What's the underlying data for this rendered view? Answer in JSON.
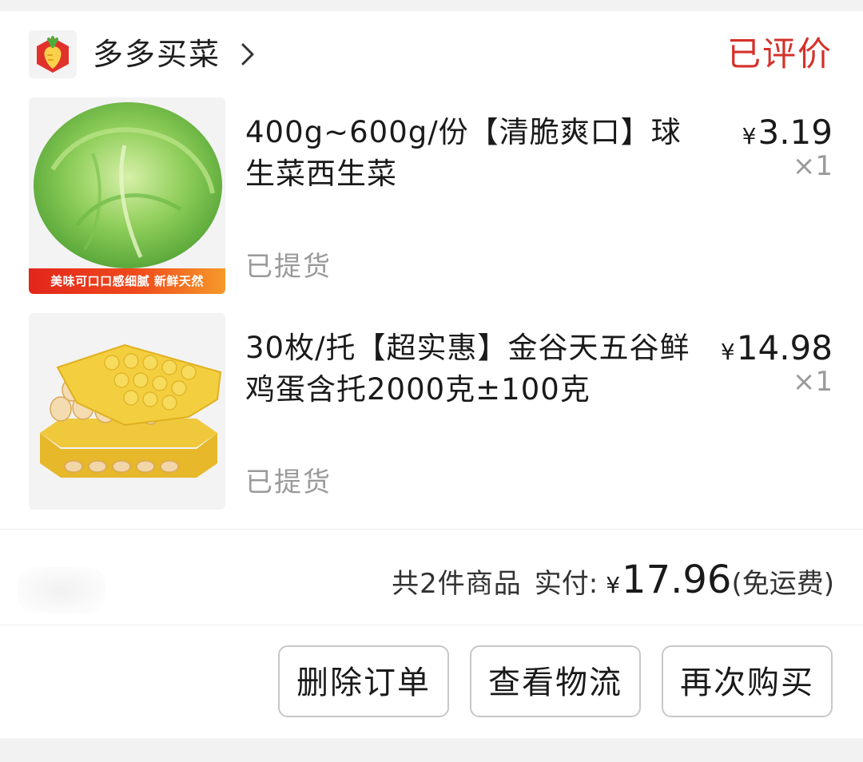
{
  "order": {
    "shop_name": "多多买菜",
    "status": "已评价",
    "items": [
      {
        "title": "400g~600g/份【清脆爽口】球生菜西生菜",
        "currency": "¥",
        "price": "3.19",
        "qty": "×1",
        "state": "已提货",
        "image_tag": "美味可口口感细腻 新鲜天然"
      },
      {
        "title": "30枚/托【超实惠】金谷天五谷鲜鸡蛋含托2000克±100克",
        "currency": "¥",
        "price": "14.98",
        "qty": "×1",
        "state": "已提货"
      }
    ],
    "summary": {
      "count_text": "共2件商品",
      "paid_label": "实付:",
      "currency": "¥",
      "total": "17.96",
      "shipping_note": "(免运费)"
    },
    "buttons": {
      "delete": "删除订单",
      "logistics": "查看物流",
      "rebuy": "再次购买"
    }
  },
  "colors": {
    "status_red": "#d5312a",
    "logo_red": "#e0322b",
    "tag_gradient_start": "#e2261b",
    "tag_gradient_end": "#f59a2a"
  },
  "icons": {
    "shop_logo": "carrot-shop-logo",
    "shop_chevron": "chevron-right-icon"
  }
}
